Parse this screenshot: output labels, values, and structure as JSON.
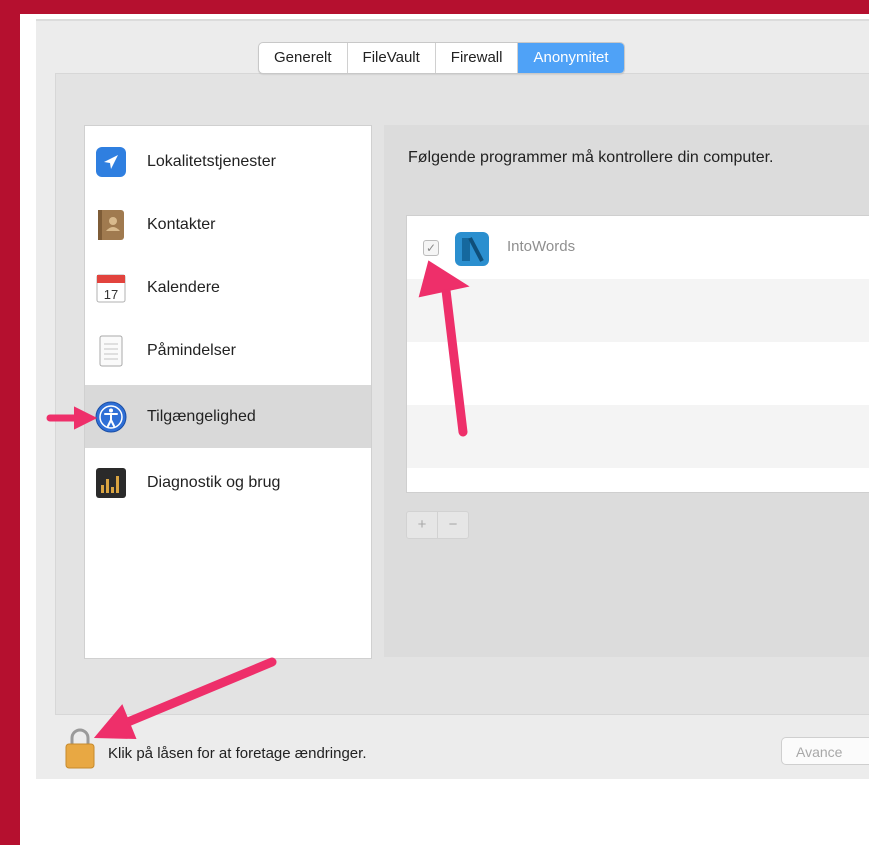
{
  "tabs": [
    {
      "label": "Generelt",
      "active": false
    },
    {
      "label": "FileVault",
      "active": false
    },
    {
      "label": "Firewall",
      "active": false
    },
    {
      "label": "Anonymitet",
      "active": true
    }
  ],
  "sidebar": {
    "items": [
      {
        "label": "Lokalitetstjenester",
        "icon": "location-arrow-icon",
        "selected": false
      },
      {
        "label": "Kontakter",
        "icon": "contacts-book-icon",
        "selected": false
      },
      {
        "label": "Kalendere",
        "icon": "calendar-icon",
        "selected": false,
        "icon_text": "17"
      },
      {
        "label": "Påmindelser",
        "icon": "reminders-notepad-icon",
        "selected": false
      },
      {
        "label": "Tilgængelighed",
        "icon": "accessibility-icon",
        "selected": true
      },
      {
        "label": "Diagnostik og brug",
        "icon": "diagnostics-chart-icon",
        "selected": false
      }
    ]
  },
  "main": {
    "heading": "Følgende programmer må kontrollere din computer.",
    "apps": [
      {
        "name": "IntoWords",
        "checked": true,
        "checkmark": "✓",
        "icon": "intowords-app-icon"
      }
    ],
    "add_label": "+",
    "remove_label": "−"
  },
  "footer": {
    "lock_label": "Klik på låsen for at foretage ændringer.",
    "advanced_label": "Avance"
  },
  "colors": {
    "frame": "#b5102f",
    "tab_active": "#4fa2f7",
    "annotation_arrow": "#ee2f6a"
  }
}
